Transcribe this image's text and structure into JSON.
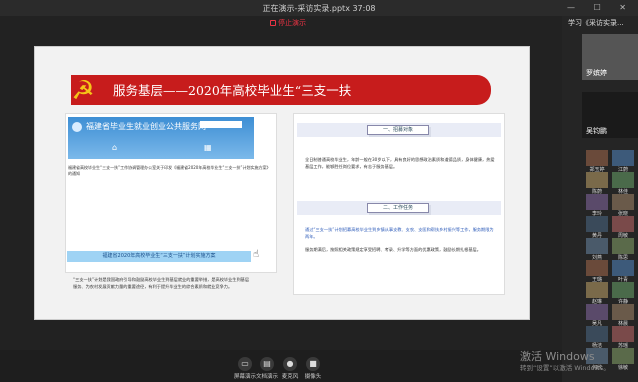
{
  "window": {
    "title": "正在演示-采访实录.pptx 37:08",
    "controls": "— ☐ ✕"
  },
  "presentation": {
    "stop_label": "停止演示",
    "slide": {
      "banner_title": "服务基层——2020年高校毕业生“三支一扶",
      "emblem": "party-emblem",
      "left_panel": {
        "site_name": "福建省毕业生就业创业公共服务网",
        "notice": "福建省高校毕业生“三支一扶”工作协调管理办公室关于印发《福建省2020年高校毕业生“三支一扶”计划实施方案》的通知",
        "strip_label": "福建省2020年高校毕业生“三支一扶”计划实施方案",
        "paragraph": "“三支一扶”计划是我国政府引导和鼓励高校毕业生到基层就业的重要举措，是高校毕业生到基层服务、为农村发展贡献力量的重要途径，有利于提升毕业生的综合素质和就业竞争力。"
      },
      "right_panel": {
        "section1": "一、招募对象",
        "text1": "全日制普通高校毕业生，年龄一般在30岁以下，具有良好的思想政治素质和道德品质，身体健康，热爱基层工作，能够胜任岗位要求，有志于服务基层。",
        "section2": "二、工作任务",
        "text2": "通过“三支一扶”计划招募高校毕业生到乡镇从事支教、支农、支医和帮扶乡村振兴等工作，服务期限为两年。",
        "text3": "服务期满后，按照相关政策规定享受招聘、考录、升学等方面的优惠政策，鼓励长期扎根基层。"
      }
    }
  },
  "sidebar": {
    "meeting_title": "学习《采访实录...",
    "big_tiles": [
      {
        "name": "罗嫔婷"
      },
      {
        "name": "吴钧鹏"
      }
    ],
    "participants": [
      {
        "name": "郑玉婷"
      },
      {
        "name": "江蔚"
      },
      {
        "name": "陈蔚"
      },
      {
        "name": "林佳"
      },
      {
        "name": "李玲"
      },
      {
        "name": "张晓"
      },
      {
        "name": "黄丹"
      },
      {
        "name": "周敏"
      },
      {
        "name": "刘燕"
      },
      {
        "name": "陈思"
      },
      {
        "name": "王璐"
      },
      {
        "name": "叶青"
      },
      {
        "name": "赵琳"
      },
      {
        "name": "许静"
      },
      {
        "name": "吴凡"
      },
      {
        "name": "林晨"
      },
      {
        "name": "杨洁"
      },
      {
        "name": "苏瑶"
      },
      {
        "name": "何欣"
      },
      {
        "name": "徐敏"
      }
    ]
  },
  "toolbar": {
    "tools": [
      {
        "label": "屏幕演示",
        "icon": "screen-icon"
      },
      {
        "label": "文档演示",
        "icon": "document-icon"
      },
      {
        "label": "麦克风",
        "icon": "microphone-icon"
      },
      {
        "label": "摄像头",
        "icon": "camera-icon"
      }
    ]
  },
  "watermark": {
    "line1": "激活 Windows",
    "line2": "转到“设置”以激活 Windows。"
  }
}
